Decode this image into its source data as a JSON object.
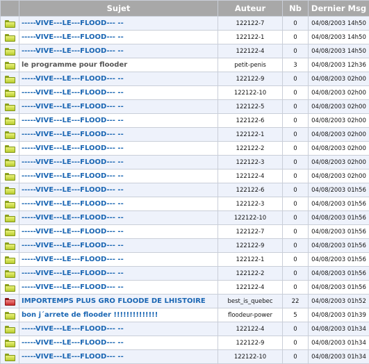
{
  "headers": {
    "icon": "",
    "subject": "Sujet",
    "author": "Auteur",
    "count": "Nb",
    "last": "Dernier Msg"
  },
  "rows": [
    {
      "icon": "folder-icon",
      "tone": "blue",
      "subject": "-----VIVE---LE---FLOOD--- --",
      "author": "122122-7",
      "count": "0",
      "last": "04/08/2003 14h50"
    },
    {
      "icon": "folder-icon",
      "tone": "blue",
      "subject": "-----VIVE---LE---FLOOD--- --",
      "author": "122122-1",
      "count": "0",
      "last": "04/08/2003 14h50"
    },
    {
      "icon": "folder-icon",
      "tone": "blue",
      "subject": "-----VIVE---LE---FLOOD--- --",
      "author": "122122-4",
      "count": "0",
      "last": "04/08/2003 14h50"
    },
    {
      "icon": "folder-icon",
      "tone": "gray",
      "subject": "le programme pour flooder",
      "author": "petit-penis",
      "count": "3",
      "last": "04/08/2003 12h36"
    },
    {
      "icon": "folder-icon",
      "tone": "blue",
      "subject": "-----VIVE---LE---FLOOD--- --",
      "author": "122122-9",
      "count": "0",
      "last": "04/08/2003 02h00"
    },
    {
      "icon": "folder-icon",
      "tone": "blue",
      "subject": "-----VIVE---LE---FLOOD--- --",
      "author": "122122-10",
      "count": "0",
      "last": "04/08/2003 02h00"
    },
    {
      "icon": "folder-icon",
      "tone": "blue",
      "subject": "-----VIVE---LE---FLOOD--- --",
      "author": "122122-5",
      "count": "0",
      "last": "04/08/2003 02h00"
    },
    {
      "icon": "folder-icon",
      "tone": "blue",
      "subject": "-----VIVE---LE---FLOOD--- --",
      "author": "122122-6",
      "count": "0",
      "last": "04/08/2003 02h00"
    },
    {
      "icon": "folder-icon",
      "tone": "blue",
      "subject": "-----VIVE---LE---FLOOD--- --",
      "author": "122122-1",
      "count": "0",
      "last": "04/08/2003 02h00"
    },
    {
      "icon": "folder-icon",
      "tone": "blue",
      "subject": "-----VIVE---LE---FLOOD--- --",
      "author": "122122-2",
      "count": "0",
      "last": "04/08/2003 02h00"
    },
    {
      "icon": "folder-icon",
      "tone": "blue",
      "subject": "-----VIVE---LE---FLOOD--- --",
      "author": "122122-3",
      "count": "0",
      "last": "04/08/2003 02h00"
    },
    {
      "icon": "folder-icon",
      "tone": "blue",
      "subject": "-----VIVE---LE---FLOOD--- --",
      "author": "122122-4",
      "count": "0",
      "last": "04/08/2003 02h00"
    },
    {
      "icon": "folder-icon",
      "tone": "blue",
      "subject": "-----VIVE---LE---FLOOD--- --",
      "author": "122122-6",
      "count": "0",
      "last": "04/08/2003 01h56"
    },
    {
      "icon": "folder-icon",
      "tone": "blue",
      "subject": "-----VIVE---LE---FLOOD--- --",
      "author": "122122-3",
      "count": "0",
      "last": "04/08/2003 01h56"
    },
    {
      "icon": "folder-icon",
      "tone": "blue",
      "subject": "-----VIVE---LE---FLOOD--- --",
      "author": "122122-10",
      "count": "0",
      "last": "04/08/2003 01h56"
    },
    {
      "icon": "folder-icon",
      "tone": "blue",
      "subject": "-----VIVE---LE---FLOOD--- --",
      "author": "122122-7",
      "count": "0",
      "last": "04/08/2003 01h56"
    },
    {
      "icon": "folder-icon",
      "tone": "blue",
      "subject": "-----VIVE---LE---FLOOD--- --",
      "author": "122122-9",
      "count": "0",
      "last": "04/08/2003 01h56"
    },
    {
      "icon": "folder-icon",
      "tone": "blue",
      "subject": "-----VIVE---LE---FLOOD--- --",
      "author": "122122-1",
      "count": "0",
      "last": "04/08/2003 01h56"
    },
    {
      "icon": "folder-icon",
      "tone": "blue",
      "subject": "-----VIVE---LE---FLOOD--- --",
      "author": "122122-2",
      "count": "0",
      "last": "04/08/2003 01h56"
    },
    {
      "icon": "folder-icon",
      "tone": "blue",
      "subject": "-----VIVE---LE---FLOOD--- --",
      "author": "122122-4",
      "count": "0",
      "last": "04/08/2003 01h56"
    },
    {
      "icon": "hot-folder-icon",
      "tone": "blue",
      "subject": "IMPORTEMPS PLUS GRO FLOODE DE LHISTOIRE",
      "author": "best_is_quebec",
      "count": "22",
      "last": "04/08/2003 01h52"
    },
    {
      "icon": "folder-icon",
      "tone": "blue",
      "subject": "bon j´arrete de flooder !!!!!!!!!!!!!!",
      "author": "floodeur-power",
      "count": "5",
      "last": "04/08/2003 01h39"
    },
    {
      "icon": "folder-icon",
      "tone": "blue",
      "subject": "-----VIVE---LE---FLOOD--- --",
      "author": "122122-4",
      "count": "0",
      "last": "04/08/2003 01h34"
    },
    {
      "icon": "folder-icon",
      "tone": "blue",
      "subject": "-----VIVE---LE---FLOOD--- --",
      "author": "122122-9",
      "count": "0",
      "last": "04/08/2003 01h34"
    },
    {
      "icon": "folder-icon",
      "tone": "blue",
      "subject": "-----VIVE---LE---FLOOD--- --",
      "author": "122122-10",
      "count": "0",
      "last": "04/08/2003 01h34"
    }
  ],
  "colors": {
    "header_bg": "#a8a8a8",
    "row_alt_bg": "#eef2fb",
    "link_blue": "#1a66b3",
    "folder_green": "#c8d84a",
    "folder_red": "#c92a2a"
  }
}
